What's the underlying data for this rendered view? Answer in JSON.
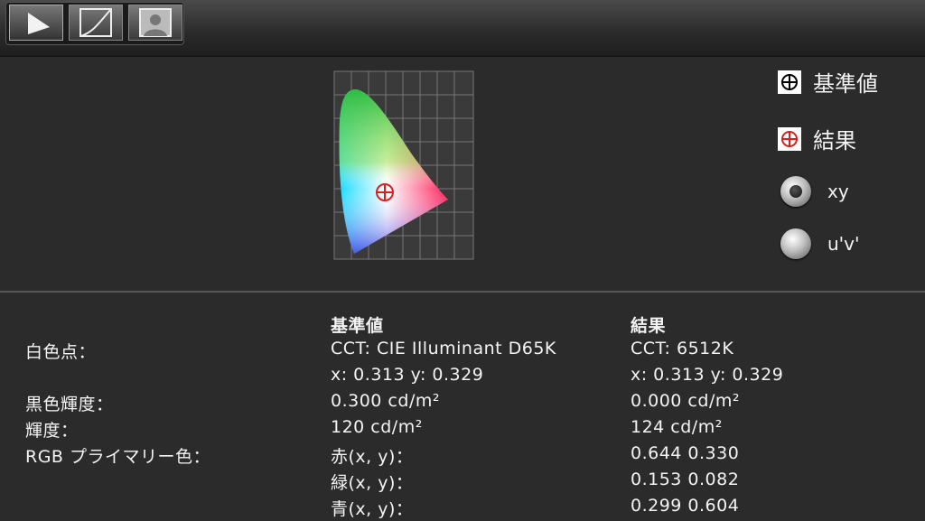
{
  "toolbar": {
    "tabs": [
      {
        "icon": "play-triangle-icon",
        "active": true
      },
      {
        "icon": "gamma-curve-icon",
        "active": false
      },
      {
        "icon": "person-portrait-icon",
        "active": false
      }
    ]
  },
  "legend": {
    "reference_label": "基準値",
    "result_label": "結果",
    "options": [
      {
        "label": "xy",
        "selected": true
      },
      {
        "label": "u'v'",
        "selected": false
      }
    ]
  },
  "info": {
    "col_reference_header": "基準値",
    "col_result_header": "結果",
    "rows": [
      {
        "label": "白色点：",
        "reference": "CCT: CIE Illuminant D65K",
        "result": "CCT: 6512K"
      },
      {
        "label": "",
        "reference": "x: 0.313  y: 0.329",
        "result": "x: 0.313  y: 0.329"
      },
      {
        "label": "黒色輝度：",
        "reference": "0.300 cd/m²",
        "result": "0.000 cd/m²"
      },
      {
        "label": "輝度：",
        "reference": "120 cd/m²",
        "result": "124 cd/m²"
      },
      {
        "label": "RGB プライマリー色：",
        "reference": "赤(x, y)：",
        "result": "0.644 0.330"
      },
      {
        "label": "",
        "reference": "緑(x, y)：",
        "result": "0.153 0.082"
      },
      {
        "label": "",
        "reference": "青(x, y)：",
        "result": "0.299 0.604"
      }
    ]
  },
  "colors": {
    "reference_marker": "#000000",
    "result_marker": "#d9201e"
  }
}
